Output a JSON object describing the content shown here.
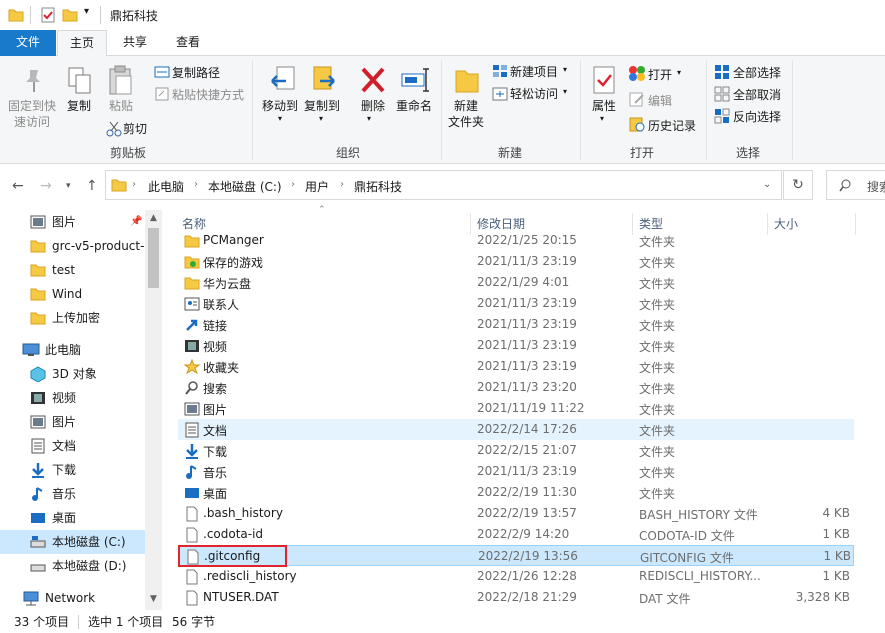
{
  "window": {
    "title": "鼎拓科技"
  },
  "ribbon_tabs": [
    "文件",
    "主页",
    "共享",
    "查看"
  ],
  "ribbon": {
    "clipboard": {
      "pin": "固定到快\n速访问",
      "copy": "复制",
      "paste": "粘贴",
      "copy_path": "复制路径",
      "paste_shortcut": "粘贴快捷方式",
      "cut": "剪切",
      "label": "剪贴板"
    },
    "organize": {
      "move_to": "移动到",
      "copy_to": "复制到",
      "delete": "删除",
      "rename": "重命名",
      "label": "组织"
    },
    "new": {
      "new_folder": "新建\n文件夹",
      "new_item": "新建项目",
      "easy_access": "轻松访问",
      "label": "新建"
    },
    "open": {
      "properties": "属性",
      "open": "打开",
      "edit": "编辑",
      "history": "历史记录",
      "label": "打开"
    },
    "select": {
      "select_all": "全部选择",
      "select_none": "全部取消",
      "invert": "反向选择",
      "label": "选择"
    }
  },
  "address": {
    "crumbs": [
      "此电脑",
      "本地磁盘 (C:)",
      "用户",
      "鼎拓科技"
    ],
    "search_placeholder": "搜索"
  },
  "nav_pane": [
    {
      "label": "图片",
      "icon": "pictures-icon",
      "pinned": true
    },
    {
      "label": "grc-v5-product-",
      "icon": "folder-icon"
    },
    {
      "label": "test",
      "icon": "folder-icon"
    },
    {
      "label": "Wind",
      "icon": "folder-icon"
    },
    {
      "label": "上传加密",
      "icon": "folder-icon"
    },
    {
      "label": "此电脑",
      "icon": "computer-icon"
    },
    {
      "label": "3D 对象",
      "icon": "3d-objects-icon"
    },
    {
      "label": "视频",
      "icon": "video-icon"
    },
    {
      "label": "图片",
      "icon": "pictures-icon"
    },
    {
      "label": "文档",
      "icon": "documents-icon"
    },
    {
      "label": "下载",
      "icon": "download-icon"
    },
    {
      "label": "音乐",
      "icon": "music-icon"
    },
    {
      "label": "桌面",
      "icon": "desktop-icon"
    },
    {
      "label": "本地磁盘 (C:)",
      "icon": "drive-icon",
      "selected": true
    },
    {
      "label": "本地磁盘 (D:)",
      "icon": "drive-icon"
    },
    {
      "label": "Network",
      "icon": "network-icon"
    }
  ],
  "columns": {
    "name": "名称",
    "modified": "修改日期",
    "type": "类型",
    "size": "大小"
  },
  "files": [
    {
      "name": "PCManger",
      "modified": "2022/1/25 20:15",
      "type": "文件夹",
      "size": "",
      "icon": "folder-icon"
    },
    {
      "name": "保存的游戏",
      "modified": "2021/11/3 23:19",
      "type": "文件夹",
      "size": "",
      "icon": "saved-games-icon"
    },
    {
      "name": "华为云盘",
      "modified": "2022/1/29 4:01",
      "type": "文件夹",
      "size": "",
      "icon": "folder-icon"
    },
    {
      "name": "联系人",
      "modified": "2021/11/3 23:19",
      "type": "文件夹",
      "size": "",
      "icon": "contacts-icon"
    },
    {
      "name": "链接",
      "modified": "2021/11/3 23:19",
      "type": "文件夹",
      "size": "",
      "icon": "links-icon"
    },
    {
      "name": "视频",
      "modified": "2021/11/3 23:19",
      "type": "文件夹",
      "size": "",
      "icon": "video-icon"
    },
    {
      "name": "收藏夹",
      "modified": "2021/11/3 23:19",
      "type": "文件夹",
      "size": "",
      "icon": "favorites-icon"
    },
    {
      "name": "搜索",
      "modified": "2021/11/3 23:20",
      "type": "文件夹",
      "size": "",
      "icon": "search-icon"
    },
    {
      "name": "图片",
      "modified": "2021/11/19 11:22",
      "type": "文件夹",
      "size": "",
      "icon": "pictures-icon"
    },
    {
      "name": "文档",
      "modified": "2022/2/14 17:26",
      "type": "文件夹",
      "size": "",
      "icon": "documents-icon"
    },
    {
      "name": "下载",
      "modified": "2022/2/15 21:07",
      "type": "文件夹",
      "size": "",
      "icon": "download-icon"
    },
    {
      "name": "音乐",
      "modified": "2021/11/3 23:19",
      "type": "文件夹",
      "size": "",
      "icon": "music-icon"
    },
    {
      "name": "桌面",
      "modified": "2022/2/19 11:30",
      "type": "文件夹",
      "size": "",
      "icon": "desktop-icon"
    },
    {
      "name": ".bash_history",
      "modified": "2022/2/19 13:57",
      "type": "BASH_HISTORY 文件",
      "size": "4 KB",
      "icon": "file-icon"
    },
    {
      "name": ".codota-id",
      "modified": "2022/2/9 14:20",
      "type": "CODOTA-ID 文件",
      "size": "1 KB",
      "icon": "file-icon"
    },
    {
      "name": ".gitconfig",
      "modified": "2022/2/19 13:56",
      "type": "GITCONFIG 文件",
      "size": "1 KB",
      "icon": "file-icon"
    },
    {
      "name": ".rediscli_history",
      "modified": "2022/1/26 12:28",
      "type": "REDISCLI_HISTORY...",
      "size": "1 KB",
      "icon": "file-icon"
    },
    {
      "name": "NTUSER.DAT",
      "modified": "2022/2/18 21:29",
      "type": "DAT 文件",
      "size": "3,328 KB",
      "icon": "file-icon"
    }
  ],
  "status": {
    "count": "33 个项目",
    "selected": "选中 1 个项目",
    "bytes": "56 字节"
  },
  "colors": {
    "accent": "#1979ca",
    "selection": "#cce8ff",
    "highlight_box": "#e0242c"
  }
}
